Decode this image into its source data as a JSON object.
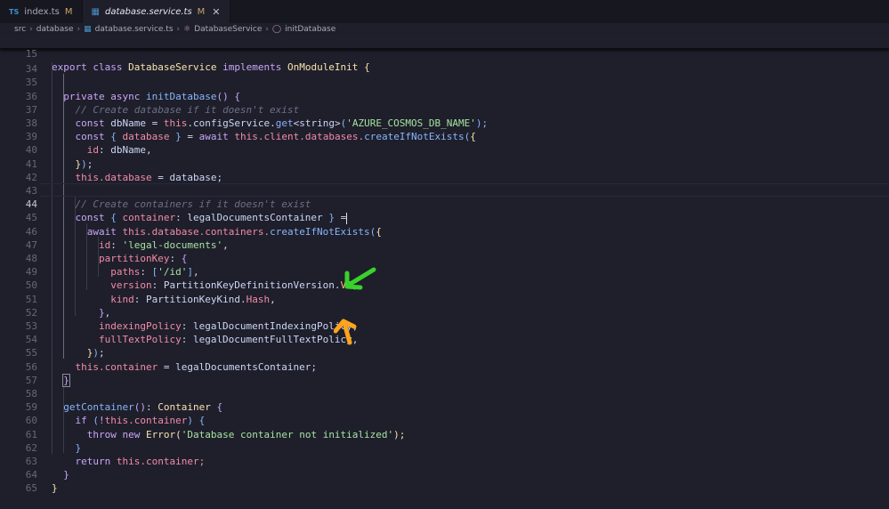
{
  "tabs": [
    {
      "icon": "TS",
      "label": "index.ts",
      "status": "M",
      "active": false
    },
    {
      "label": "database.service.ts",
      "status": "M",
      "active": true,
      "close": "✕"
    }
  ],
  "breadcrumb": [
    "src",
    "database",
    "database.service.ts",
    "DatabaseService",
    "initDatabase"
  ],
  "lines": [
    {
      "n": "15"
    },
    {
      "n": "34"
    },
    {
      "n": "35"
    },
    {
      "n": "36"
    },
    {
      "n": "37"
    },
    {
      "n": "38"
    },
    {
      "n": "39"
    },
    {
      "n": "40"
    },
    {
      "n": "41"
    },
    {
      "n": "42"
    },
    {
      "n": "43"
    },
    {
      "n": "44"
    },
    {
      "n": "45"
    },
    {
      "n": "46"
    },
    {
      "n": "47"
    },
    {
      "n": "48"
    },
    {
      "n": "49"
    },
    {
      "n": "50"
    },
    {
      "n": "51"
    },
    {
      "n": "52"
    },
    {
      "n": "53"
    },
    {
      "n": "54"
    },
    {
      "n": "55"
    },
    {
      "n": "56"
    },
    {
      "n": "57"
    },
    {
      "n": "58"
    },
    {
      "n": "59"
    },
    {
      "n": "60"
    },
    {
      "n": "61"
    },
    {
      "n": "62"
    },
    {
      "n": "63"
    },
    {
      "n": "64"
    },
    {
      "n": "65"
    }
  ],
  "code": {
    "l15": [
      "export",
      "class",
      "DatabaseService",
      "implements",
      "OnModuleInit",
      "{"
    ],
    "l35": [
      "private",
      "async",
      "initDatabase",
      "()",
      "{"
    ],
    "l36": "// Create database if it doesn't exist",
    "l37": [
      "const",
      "dbName",
      "=",
      "this",
      ".configService.",
      "get",
      "<string>",
      "(",
      "'AZURE_COSMOS_DB_NAME'",
      ");"
    ],
    "l38": [
      "const",
      "{",
      "database",
      "}",
      "=",
      "await",
      "this",
      ".client.databases.",
      "createIfNotExists",
      "(",
      "{"
    ],
    "l39": [
      "id",
      ": dbName,"
    ],
    "l40": [
      "}",
      ")",
      ";"
    ],
    "l41": [
      "this",
      ".database",
      " = database;"
    ],
    "l43": "// Create containers if it doesn't exist",
    "l44": [
      "const",
      "{",
      "container",
      ":",
      "legalDocumentsContainer",
      "}",
      "="
    ],
    "l45": [
      "await",
      "this",
      ".database.containers.",
      "createIfNotExists",
      "(",
      "{"
    ],
    "l46": [
      "id",
      ":",
      "'legal-documents'",
      ","
    ],
    "l47": [
      "partitionKey",
      ":",
      "{"
    ],
    "l48": [
      "paths",
      ":",
      "[",
      "'/id'",
      "]",
      ","
    ],
    "l49": [
      "version",
      ": PartitionKeyDefinitionVersion.",
      "V2",
      ","
    ],
    "l50": [
      "kind",
      ": PartitionKeyKind.",
      "Hash",
      ","
    ],
    "l51": [
      "}",
      ","
    ],
    "l52": [
      "indexingPolicy",
      ": legalDocumentIndexingPolicy,"
    ],
    "l53": [
      "fullTextPolicy",
      ": legalDocumentFullTextPolicy,"
    ],
    "l54": [
      "}",
      ")",
      ";"
    ],
    "l55": [
      "this",
      ".container",
      " = legalDocumentsContainer;"
    ],
    "l56": "}",
    "l58": [
      "getContainer",
      "()",
      ": ",
      "Container",
      "{"
    ],
    "l59": [
      "if",
      "(",
      "!",
      "this",
      ".container",
      ")",
      "{"
    ],
    "l60": [
      "throw",
      "new",
      "Error",
      "(",
      "'Database container not initialized'",
      ");"
    ],
    "l61": "}",
    "l62": [
      "return",
      "this",
      ".container;"
    ],
    "l63": "}",
    "l64": "}"
  },
  "annotations": [
    {
      "name": "green-arrow",
      "color": "#39d12b"
    },
    {
      "name": "orange-arrow",
      "color": "#ffa41b"
    }
  ]
}
